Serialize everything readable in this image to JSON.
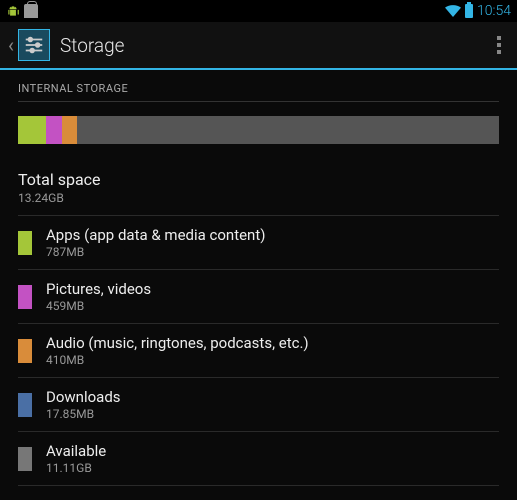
{
  "status": {
    "time": "10:54"
  },
  "header": {
    "title": "Storage"
  },
  "section": {
    "label": "INTERNAL STORAGE"
  },
  "total": {
    "label": "Total space",
    "value": "13.24GB"
  },
  "colors": {
    "apps": "#a4c639",
    "pictures": "#c352c3",
    "audio": "#d98c3a",
    "downloads": "#4a6fa5",
    "available": "#777"
  },
  "usage_bar": {
    "apps_pct": 5.8,
    "pictures_pct": 3.4,
    "audio_pct": 3.0,
    "remaining_pct": 87.8
  },
  "rows": [
    {
      "key": "apps",
      "label": "Apps (app data & media content)",
      "value": "787MB"
    },
    {
      "key": "pictures",
      "label": "Pictures, videos",
      "value": "459MB"
    },
    {
      "key": "audio",
      "label": "Audio (music, ringtones, podcasts, etc.)",
      "value": "410MB"
    },
    {
      "key": "downloads",
      "label": "Downloads",
      "value": "17.85MB"
    },
    {
      "key": "available",
      "label": "Available",
      "value": "11.11GB"
    }
  ]
}
